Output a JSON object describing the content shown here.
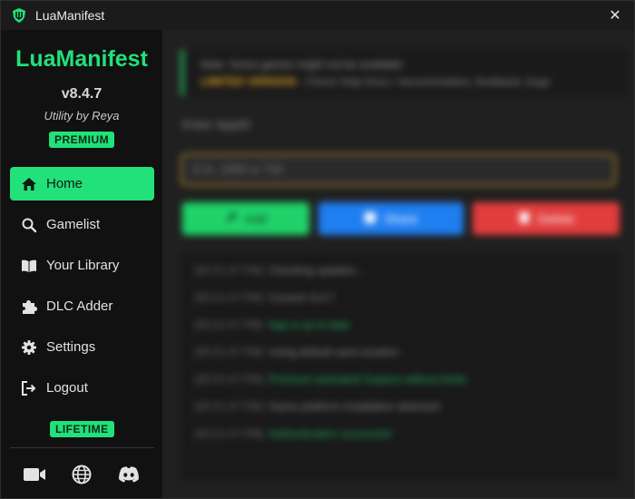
{
  "window": {
    "title": "LuaManifest",
    "close_label": "✕"
  },
  "sidebar": {
    "brand": "LuaManifest",
    "version": "v8.4.7",
    "author": "Utility by Reya",
    "tier_badge": "PREMIUM",
    "items": [
      {
        "label": "Home",
        "icon": "home-icon",
        "active": true
      },
      {
        "label": "Gamelist",
        "icon": "search-icon"
      },
      {
        "label": "Your Library",
        "icon": "book-icon"
      },
      {
        "label": "DLC Adder",
        "icon": "puzzle-icon"
      },
      {
        "label": "Settings",
        "icon": "gear-icon"
      },
      {
        "label": "Logout",
        "icon": "logout-icon"
      }
    ],
    "license_badge": "LIFETIME",
    "social": [
      "video-icon",
      "globe-icon",
      "discord-icon"
    ]
  },
  "main": {
    "notice": {
      "line1": "Note: Some games might not be available",
      "line2_highlight": "LIMITED VERSION",
      "line2_rest": " - Check Help Docs / documentation, feedback, bugs"
    },
    "input_label": "Enter AppID",
    "input_placeholder": "E.G. 1850 or 730",
    "buttons": {
      "add": "Add",
      "share": "Share",
      "delete": "Delete"
    },
    "log": [
      {
        "time": "[00:21:47 PM]",
        "msg": "Checking updates...",
        "ok": false
      },
      {
        "time": "[00:21:47 PM]",
        "msg": "Current: 8.4.7",
        "ok": false
      },
      {
        "time": "[00:21:47 PM]",
        "msg": "App is up to date",
        "ok": true
      },
      {
        "time": "[00:21:47 PM]",
        "msg": "Using default save location",
        "ok": false
      },
      {
        "time": "[00:21:47 PM]",
        "msg": "Premium activated! Explore without limits",
        "ok": true
      },
      {
        "time": "[00:21:47 PM]",
        "msg": "Game platform installation detected",
        "ok": false
      },
      {
        "time": "[00:21:47 PM]",
        "msg": "Authentication successful",
        "ok": true
      }
    ]
  },
  "colors": {
    "accent": "#22e07a",
    "add": "#1fd36a",
    "share": "#1f7ef0",
    "delete": "#e23d3d",
    "warning_border": "#b08a2a"
  }
}
